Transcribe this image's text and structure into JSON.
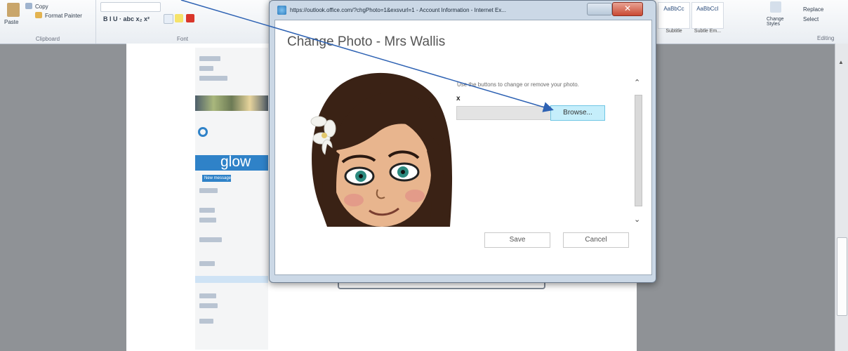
{
  "ribbon": {
    "paste_label": "Paste",
    "copy_label": "Copy",
    "format_painter_label": "Format Painter",
    "clipboard_group": "Clipboard",
    "font_group": "Font",
    "font_format_buttons": "B  I  U  ·  abc  x₂  x²",
    "styles": [
      "AaBbCc",
      "AaBbCcI"
    ],
    "style_names": [
      "Subtitle",
      "Subtle Em..."
    ],
    "change_styles_label": "Change Styles",
    "replace_label": "Replace",
    "select_label": "Select",
    "editing_group": "Editing"
  },
  "embedded": {
    "app_name": "glow",
    "new_message": "New message"
  },
  "dialog": {
    "window_title": "https://outlook.office.com/?chgPhoto=1&exsvurl=1 - Account Information - Internet Ex...",
    "close_glyph": "✕",
    "heading": "Change Photo - Mrs Wallis",
    "hint": "Use the buttons to change or remove your photo.",
    "remove_glyph": "x",
    "browse_label": "Browse...",
    "save_label": "Save",
    "cancel_label": "Cancel",
    "scroll_up_glyph": "⌃",
    "scroll_down_glyph": "⌄"
  },
  "icons": {
    "arrow_color": "#2e62b3",
    "close_color": "#c94a33",
    "accent": "#2f82c8"
  }
}
